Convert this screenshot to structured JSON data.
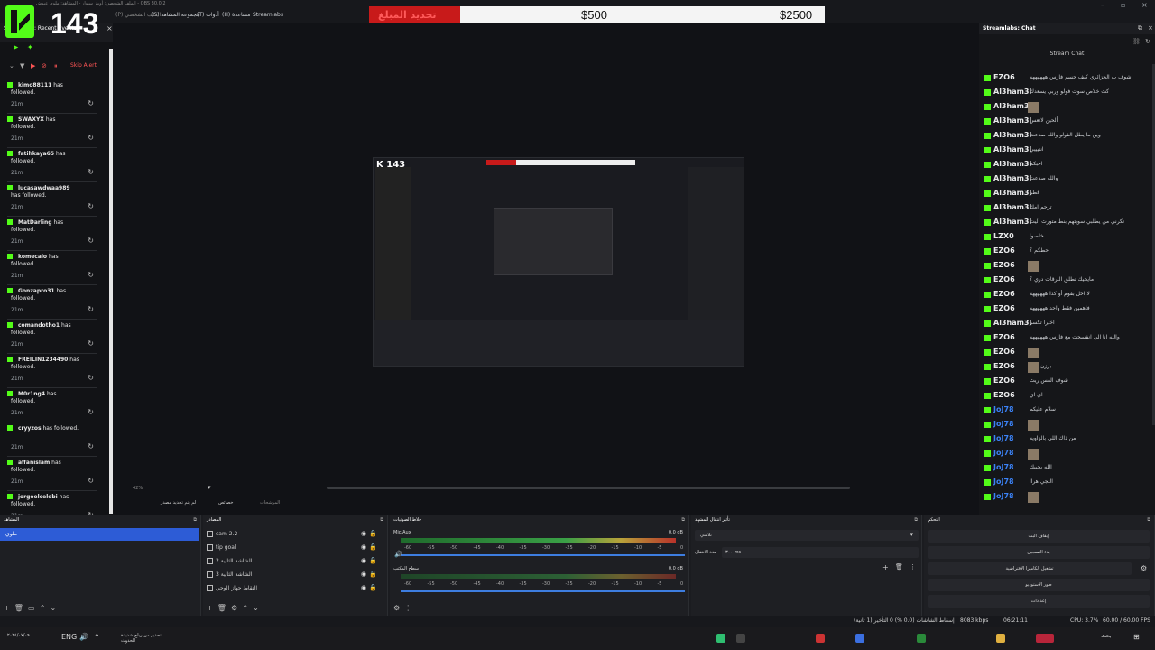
{
  "window": {
    "title": "الملف الشخصي: أوبيز سبوار - المشاهد: ملوي عيوش - OBS 30.0.2",
    "menu": [
      "Streamlabs",
      "(H) مساعدة",
      "(T) أدوات",
      "(S) مجموعة المشاهد",
      "(P) الملف الشخصي",
      "(V) عرض",
      "(D) لوحات",
      "(E) تعديل",
      "(F) ملف"
    ]
  },
  "overlay": {
    "logo_number": "143",
    "goal_label": "تحديد المبلغ",
    "goal_current": "$500",
    "goal_target": "$2500",
    "goal_fraction": 0.2
  },
  "recent_events": {
    "title": "Streamlabs: Recent Events",
    "skip_alert": "Skip Alert",
    "items": [
      {
        "user": "kimo88111",
        "action": "has followed.",
        "time": "21m"
      },
      {
        "user": "SWAXYX",
        "action": "has followed.",
        "time": "21m"
      },
      {
        "user": "fatihkaya65",
        "action": "has followed.",
        "time": "21m"
      },
      {
        "user": "lucasawdwaa989",
        "action": "has followed.",
        "time": "21m"
      },
      {
        "user": "MatDarling",
        "action": "has followed.",
        "time": "21m"
      },
      {
        "user": "komecalo",
        "action": "has followed.",
        "time": "21m"
      },
      {
        "user": "Gonzapro31",
        "action": "has followed.",
        "time": "21m"
      },
      {
        "user": "comandotho1",
        "action": "has followed.",
        "time": "21m"
      },
      {
        "user": "FREILIN1234490",
        "action": "has followed.",
        "time": "21m"
      },
      {
        "user": "M0r1ng4",
        "action": "has followed.",
        "time": "21m"
      },
      {
        "user": "cryyzos",
        "action": "has followed.",
        "time": "21m"
      },
      {
        "user": "affanislam",
        "action": "has followed.",
        "time": "21m"
      },
      {
        "user": "jorgeelcelebi",
        "action": "has followed.",
        "time": "21m"
      }
    ]
  },
  "preview": {
    "zoom": "42%",
    "toolbar": [
      "لم يتم تحديد مصدر",
      "خصائص",
      "المرشحات"
    ]
  },
  "chat": {
    "title": "Streamlabs: Chat",
    "subtitle": "Stream Chat",
    "messages": [
      {
        "user": "EZO6",
        "text": "شوف ب الجزائري كيف حسم فارس ههههههه",
        "color": "white"
      },
      {
        "user": "Al3ham3l",
        "text": "كث خلاص سوت فولو وربي يسعدك",
        "color": "white"
      },
      {
        "user": "Al3ham3l",
        "text": "",
        "color": "white",
        "emote": true
      },
      {
        "user": "Al3ham3l",
        "text": "ألحين لاتعس",
        "color": "white"
      },
      {
        "user": "Al3ham3l",
        "text": "وين ما يطل الفولو والله صدعت",
        "color": "white"
      },
      {
        "user": "Al3ham3l",
        "text": "انتيييي",
        "color": "white"
      },
      {
        "user": "Al3ham3l",
        "text": "احبكم",
        "color": "white"
      },
      {
        "user": "Al3ham3l",
        "text": "والله صدعت",
        "color": "white"
      },
      {
        "user": "Al3ham3l",
        "text": "قطر",
        "color": "white"
      },
      {
        "user": "Al3ham3l",
        "text": "ترحم امك",
        "color": "white"
      },
      {
        "user": "Al3ham3l",
        "text": "تكرني من يطلبي سويتهم بنط متورث أليت",
        "color": "white"
      },
      {
        "user": "LZX0",
        "text": "خلصوا",
        "color": "white"
      },
      {
        "user": "EZO6",
        "text": "حطكم ؟",
        "color": "white"
      },
      {
        "user": "EZO6",
        "text": "",
        "color": "white",
        "emote": true
      },
      {
        "user": "EZO6",
        "text": "مايجيك تطلق البرقات دري ؟",
        "color": "white"
      },
      {
        "user": "EZO6",
        "text": "لا احل بقوم أو كذا ههههههه",
        "color": "white"
      },
      {
        "user": "EZO6",
        "text": "فاهمين فقط واحد ههههههه",
        "color": "white"
      },
      {
        "user": "Al3ham3l",
        "text": "اخيرا تكسر",
        "color": "white"
      },
      {
        "user": "EZO6",
        "text": "والله انا الي انفسحت مع فارس ههههههه",
        "color": "white"
      },
      {
        "user": "EZO6",
        "text": "",
        "color": "white",
        "emote": true
      },
      {
        "user": "EZO6",
        "text": "برزن",
        "color": "white",
        "emote": true
      },
      {
        "user": "EZO6",
        "text": "شوف الفس ريث",
        "color": "white"
      },
      {
        "user": "EZO6",
        "text": "اي اي",
        "color": "white"
      },
      {
        "user": "JoJ78",
        "text": "سلام عليكم",
        "color": "blue"
      },
      {
        "user": "JoJ78",
        "text": "",
        "color": "blue",
        "emote": true
      },
      {
        "user": "JoJ78",
        "text": "من ذاك اللي بالزاويه",
        "color": "blue"
      },
      {
        "user": "JoJ78",
        "text": "",
        "color": "blue",
        "emote": true
      },
      {
        "user": "JoJ78",
        "text": "الله يحييك",
        "color": "blue"
      },
      {
        "user": "JoJ78",
        "text": "التجي هراا",
        "color": "blue"
      },
      {
        "user": "JoJ78",
        "text": "",
        "color": "blue",
        "emote": true
      }
    ]
  },
  "docks": {
    "scenes": {
      "title": "المشاهد",
      "selected": "ملوي"
    },
    "sources": {
      "title": "المصادر",
      "items": [
        "cam 2.2",
        "tip goal",
        "الشاشة الثانية 2",
        "الشاشة الثانية 3",
        "التقاط جهاز الوحي"
      ]
    },
    "mixer": {
      "title": "خلاط الصوتيات",
      "tracks": [
        {
          "name": "Mic/Aux",
          "db": "0.0 dB"
        },
        {
          "name": "سطح المكتب",
          "db": "0.0 dB"
        }
      ],
      "ticks": [
        "-60",
        "-55",
        "-50",
        "-45",
        "-40",
        "-35",
        "-30",
        "-25",
        "-20",
        "-15",
        "-10",
        "-5",
        "0"
      ]
    },
    "transitions": {
      "title": "تأثير انتقال المشهد",
      "type": "تلاشي",
      "duration_label": "مدة الانتقال",
      "duration": "٣٠٠ ms"
    },
    "controls": {
      "title": "التحكم",
      "buttons": [
        "إيقاف البث",
        "بدء التسجيل",
        "تشغيل الكاميرا الافتراضية",
        "طور الاستوديو",
        "إعدادات"
      ]
    }
  },
  "status": {
    "delay": "التأخير (1 ثانية)",
    "dropped": "إسقاط الشاشات (0.0 %) 0",
    "bitrate": "8083 kbps",
    "time": "06:21:11",
    "cpu": "CPU: 3.7%",
    "fps": "60.00 / 60.00 FPS"
  },
  "taskbar": {
    "lang": "ENG",
    "notification": "تحذير من رياح شديدة الحدوث",
    "search": "بحث",
    "date": "٢٠٢٤/٠٧/٠٩"
  }
}
